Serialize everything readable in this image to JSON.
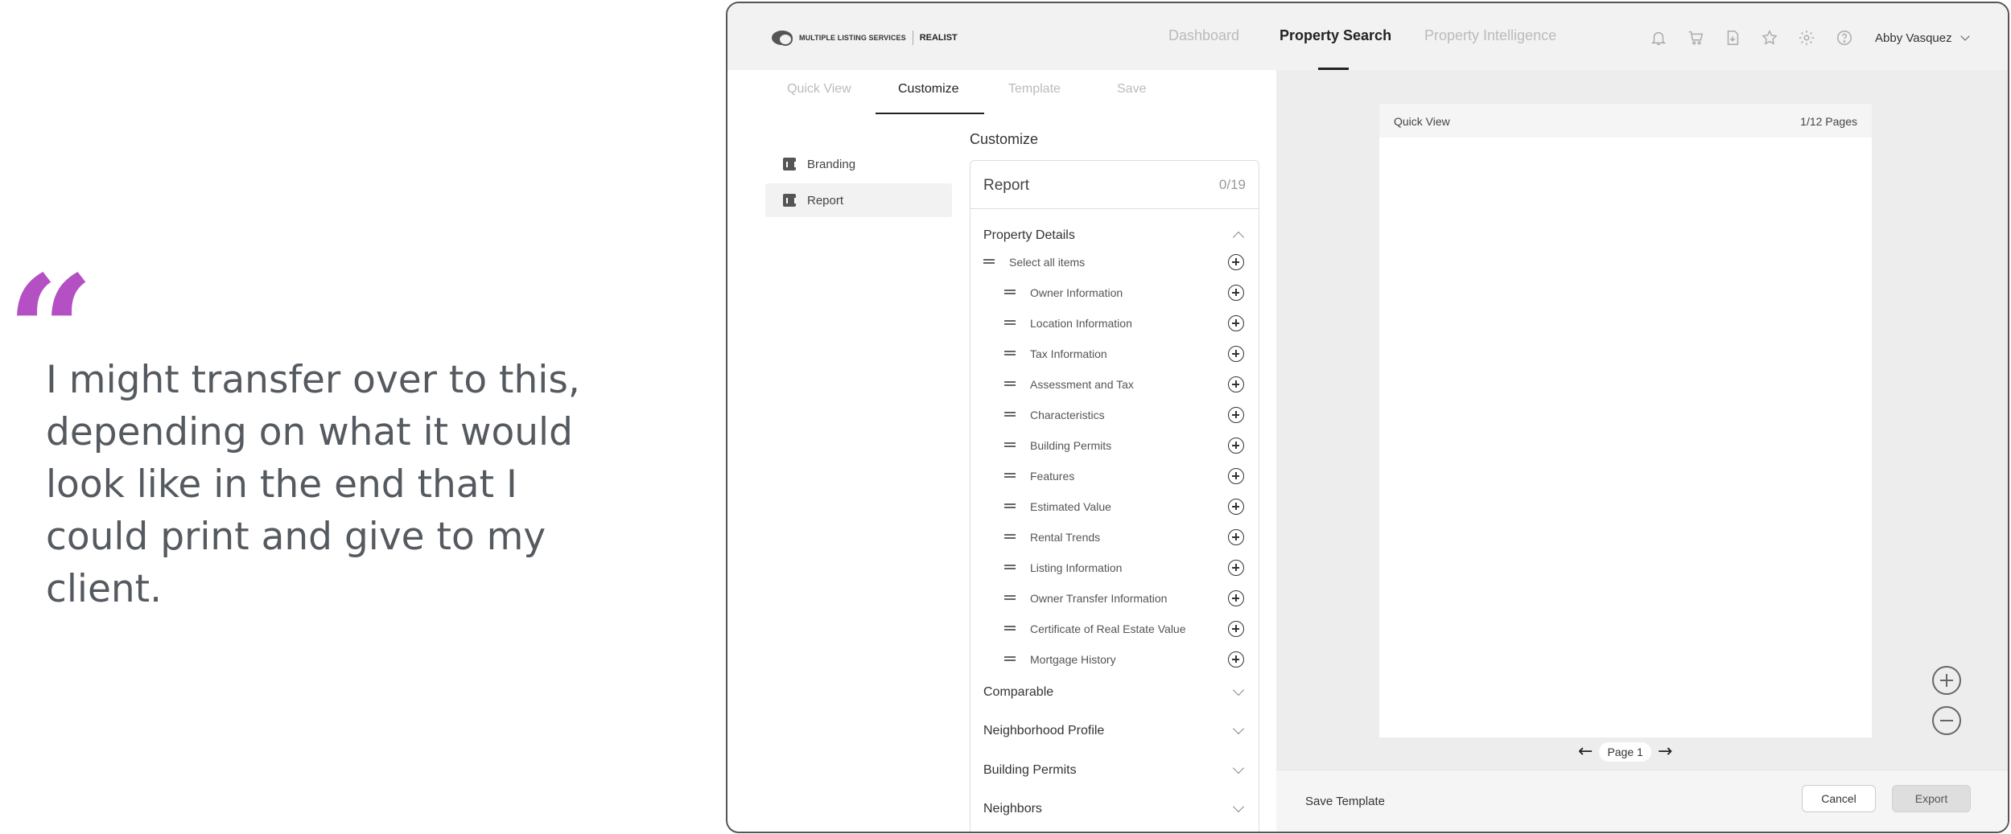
{
  "quote": {
    "text": "I might transfer over to this, depending on what it would look like in the end that I could print and give to my client."
  },
  "header": {
    "logo_text": "MULTIPLE LISTING SERVICES",
    "logo_brand": "REALIST",
    "nav": [
      "Dashboard",
      "Property Search",
      "Property Intelligence"
    ],
    "active_nav": "Property Search",
    "user_name": "Abby Vasquez"
  },
  "subtabs": [
    "Quick View",
    "Customize",
    "Template",
    "Save"
  ],
  "sidebar": {
    "items": [
      {
        "label": "Branding"
      },
      {
        "label": "Report"
      }
    ]
  },
  "customize": {
    "title": "Customize",
    "report_label": "Report",
    "report_count": "0/19",
    "property_details": {
      "title": "Property Details",
      "select_all": "Select all items",
      "items": [
        "Owner Information",
        "Location Information",
        "Tax Information",
        "Assessment and Tax",
        "Characteristics",
        "Building Permits",
        "Features",
        "Estimated Value",
        "Rental Trends",
        "Listing Information",
        "Owner Transfer Information",
        "Certificate of Real Estate Value",
        "Mortgage History"
      ]
    },
    "collapsed_sections": [
      "Comparable",
      "Neighborhood Profile",
      "Building Permits",
      "Neighbors"
    ]
  },
  "preview": {
    "title": "Quick View",
    "pages": "1/12 Pages",
    "page_label": "Page 1"
  },
  "footer": {
    "save_template": "Save Template",
    "cancel": "Cancel",
    "export": "Export"
  }
}
